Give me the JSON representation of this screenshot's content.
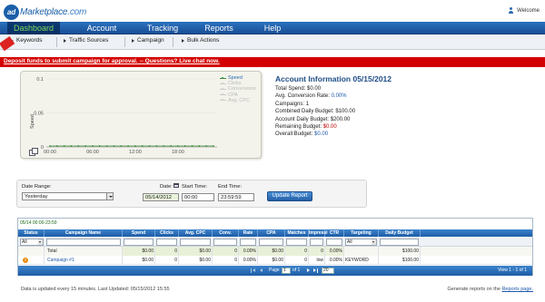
{
  "brand": {
    "logo_ad": "ad",
    "logo_text": "Marketplace",
    "logo_suffix": ".com",
    "welcome": "Welcome"
  },
  "mainnav": {
    "items": [
      "Dashboard",
      "Account",
      "Tracking",
      "Reports",
      "Help"
    ],
    "active": "Dashboard"
  },
  "subnav": {
    "items": [
      "Keywords",
      "Traffic Sources",
      "Campaign",
      "Bulk Actions"
    ]
  },
  "banner": {
    "text": "Deposit funds to submit campaign for approval. -- Questions? Live chat now."
  },
  "chart_data": {
    "type": "line",
    "x": [
      "00:00",
      "06:00",
      "12:00",
      "18:00"
    ],
    "series": [
      {
        "name": "Speed",
        "values": [
          0,
          0,
          0,
          0,
          0,
          0,
          0,
          0,
          0,
          0,
          0,
          0,
          0,
          0,
          0,
          0,
          0,
          0,
          0,
          0,
          0,
          0,
          0,
          0
        ]
      }
    ],
    "ylabel": "Speed",
    "yticks": [
      "0.1",
      "0.05",
      "0"
    ],
    "ylim": [
      0,
      0.1
    ],
    "legend": [
      "Speed",
      "Clicks",
      "Conversions",
      "CPA",
      "Avg. CPC"
    ],
    "legend_active": "Speed",
    "legend_position": "right"
  },
  "account": {
    "title": "Account Information 05/15/2012",
    "lines": [
      {
        "label": "Total Spend: ",
        "value": "$0.00",
        "color": "plain"
      },
      {
        "label": "Avg. Conversion Rate: ",
        "value": "0.00%",
        "color": "blue"
      },
      {
        "label": "Campaigns: ",
        "value": "1",
        "color": "plain"
      },
      {
        "label": "Combined Daily Budget: ",
        "value": "$100.00",
        "color": "plain"
      },
      {
        "label": "Account Daily Budget: ",
        "value": "$200.00",
        "color": "plain"
      },
      {
        "label": "Remaining Budget: ",
        "value": "$0.00",
        "color": "red"
      },
      {
        "label": "Overall Budget: ",
        "value": "$0.00",
        "color": "blue"
      }
    ]
  },
  "filters": {
    "date_range_label": "Date Range:",
    "date_range_value": "Yesterday",
    "date_label": "Date:",
    "date_value": "05/14/2012",
    "start_label": "Start Time:",
    "start_value": "00:00",
    "end_label": "End Time:",
    "end_value": "23:59:59",
    "update_button": "Update Report"
  },
  "grid": {
    "range": "05/14 00:00-23:59",
    "columns": [
      "Status",
      "Campaign Name",
      "Spend",
      "Clicks",
      "Avg. CPC",
      "Conv.",
      "Rate",
      "CPA",
      "Matches",
      "Impressi",
      "CTR",
      "Targeting",
      "Daily Budget"
    ],
    "status_filter": "All",
    "targeting_filter": "All",
    "total_row": {
      "name": "Total",
      "spend": "$0.00",
      "clicks": "0",
      "avg_cpc": "$0.00",
      "conv": "0",
      "rate": "0.00%",
      "cpa": "$0.00",
      "matches": "0",
      "impr": "0",
      "ctr": "0.00%",
      "targeting": "",
      "budget": "$100.00"
    },
    "rows": [
      {
        "status": "!",
        "name": "Campaign #1",
        "spend": "$0.00",
        "clicks": "0",
        "avg_cpc": "$0.00",
        "conv": "0",
        "rate": "0.00%",
        "cpa": "$0.00",
        "matches": "0",
        "impr": "low",
        "ctr": "0.00%",
        "targeting": "KEYWORD",
        "budget": "$100.00"
      }
    ],
    "pager": {
      "page_label": "Page",
      "page_value": "1",
      "of_label": "of 1",
      "per_page": "20",
      "view_text": "View 1 - 1 of 1"
    }
  },
  "footer": {
    "updated": "Data is updated every 15 minutes. Last Updated: 05/15/2012 15:55",
    "reports_prefix": "Generate reports on the ",
    "reports_link": "Reports page."
  },
  "colors": {
    "nav": "#1a4f96",
    "nav_active_text": "#7ed85a",
    "banner": "#d40000",
    "accent": "#1e4d86"
  }
}
